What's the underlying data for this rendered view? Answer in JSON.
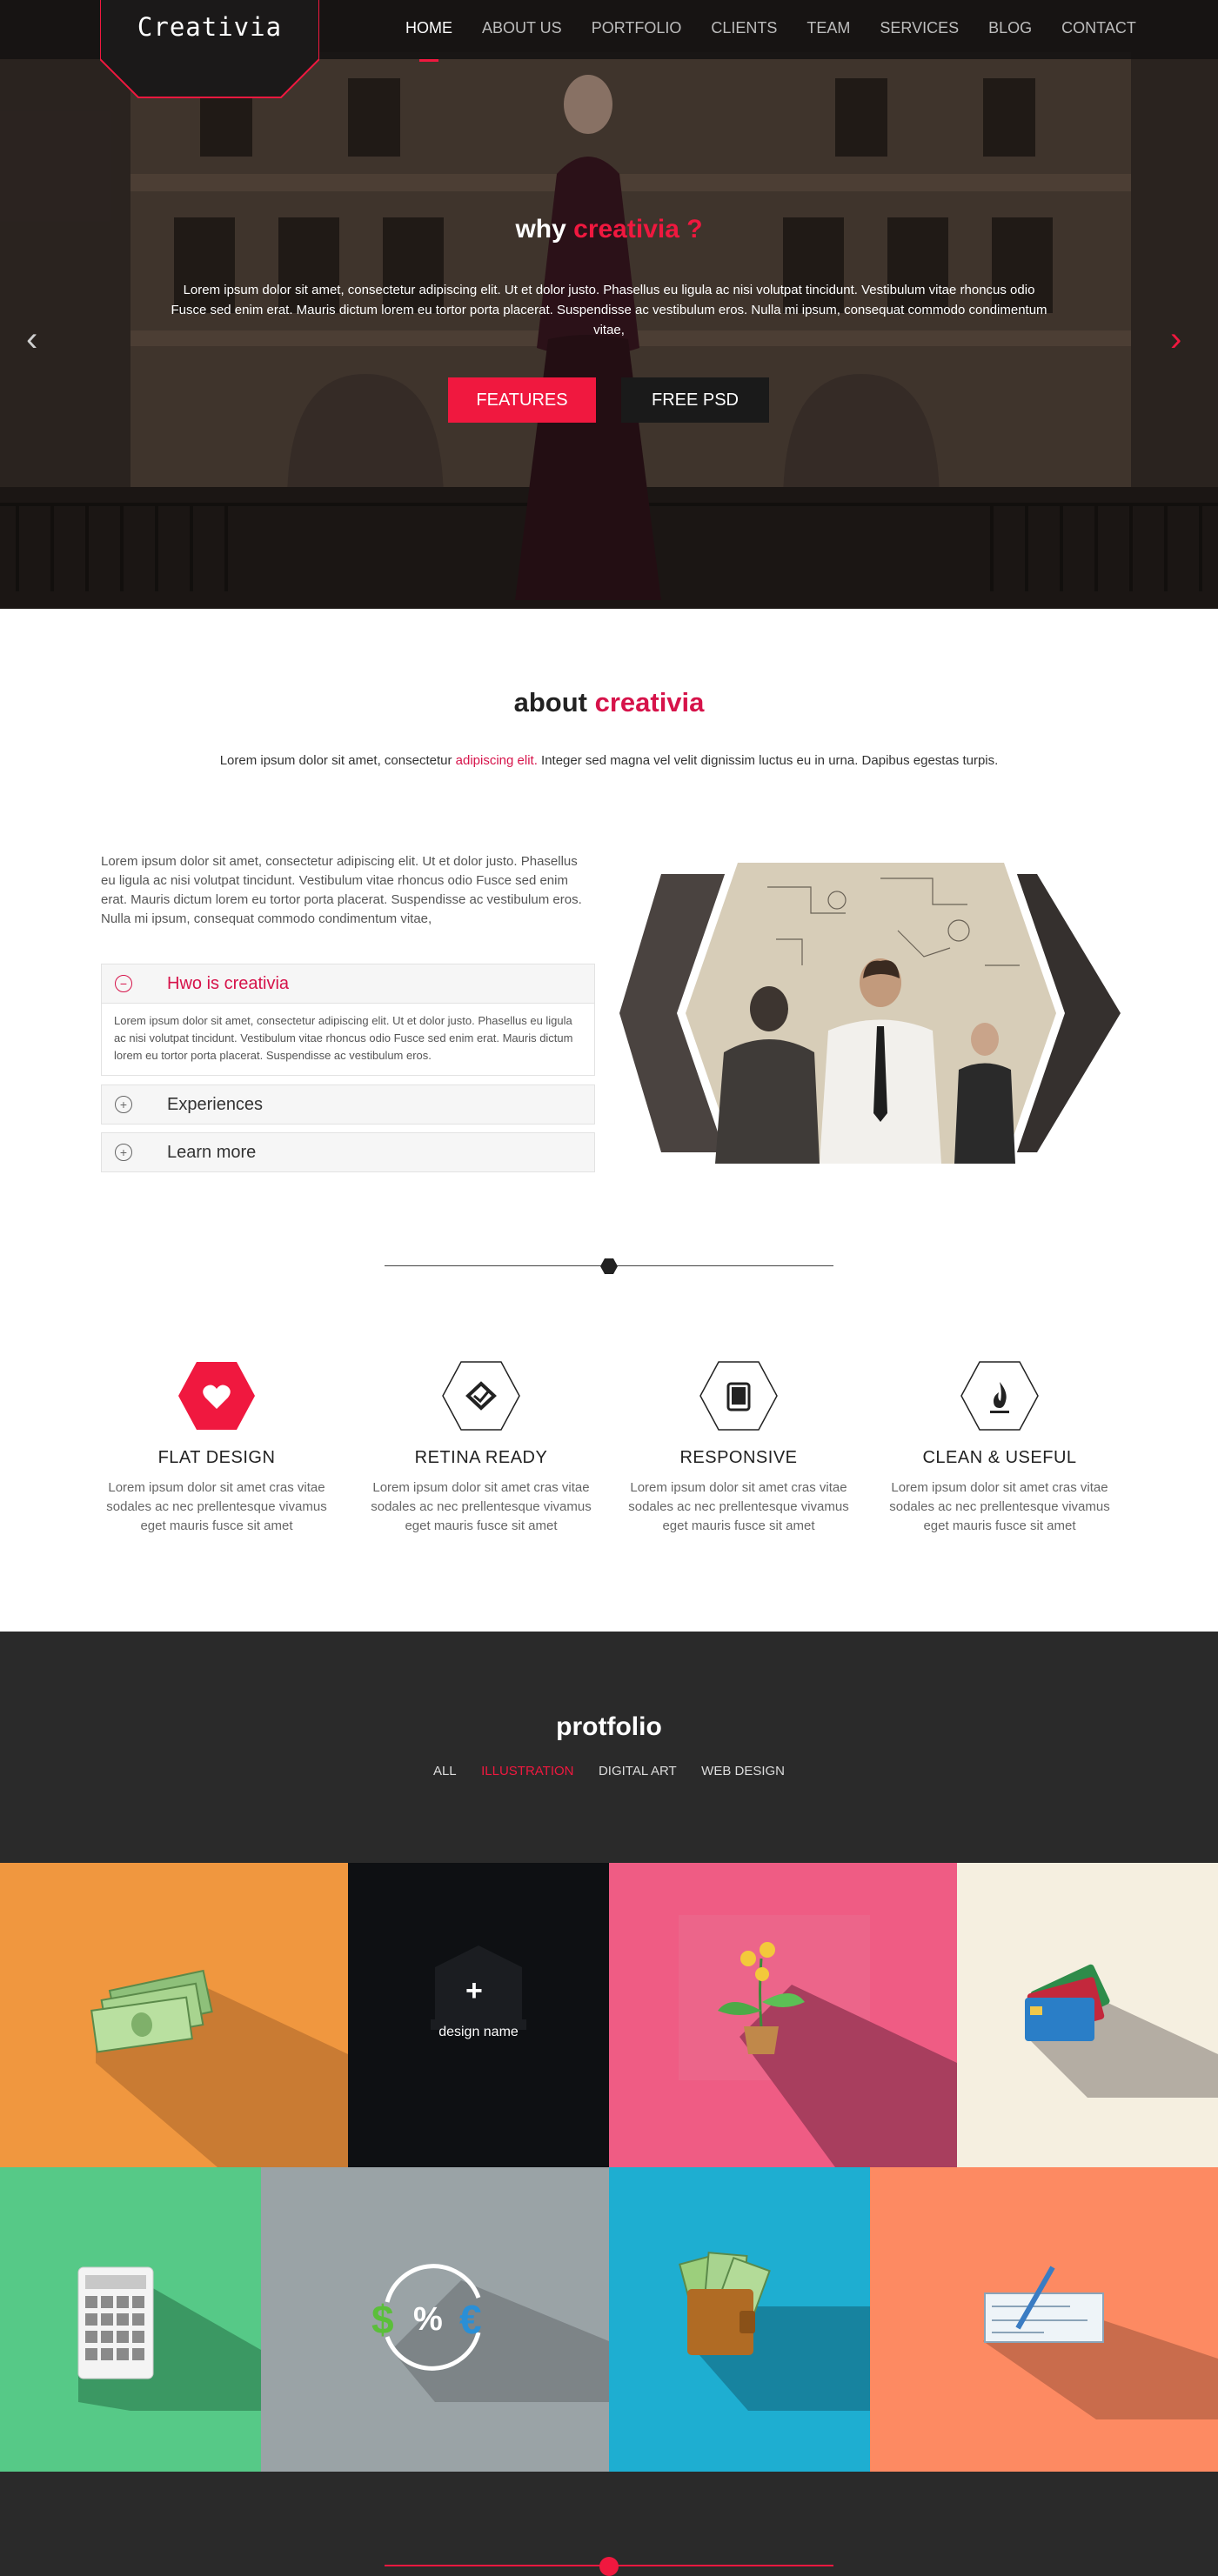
{
  "colors": {
    "accent": "#f0183f",
    "dark": "#2a2a2a",
    "nav_bg": "#141212"
  },
  "brand": {
    "logo_text": "Creativia"
  },
  "nav": {
    "items": [
      "HOME",
      "ABOUT US",
      "PORTFOLIO",
      "CLIENTS",
      "TEAM",
      "SERVICES",
      "BLOG",
      "CONTACT"
    ],
    "active": "HOME"
  },
  "hero": {
    "title_prefix": "why",
    "title_accent": "creativia ?",
    "text": "Lorem ipsum dolor sit amet, consectetur adipiscing elit. Ut et dolor justo. Phasellus eu ligula ac nisi volutpat tincidunt. Vestibulum vitae rhoncus odio Fusce sed enim erat. Mauris dictum lorem eu tortor porta placerat. Suspendisse ac vestibulum eros. Nulla mi ipsum, consequat commodo condimentum vitae,",
    "btn_features": "FEATURES",
    "btn_psd": "FREE PSD",
    "arrow_left": "‹",
    "arrow_right": "›"
  },
  "about": {
    "title_prefix": "about",
    "title_accent": "creativia",
    "lead_before": "Lorem ipsum dolor sit amet, consectetur ",
    "lead_highlight": "adipiscing elit.",
    "lead_after": " Integer sed magna vel velit dignissim luctus eu in urna. Dapibus egestas turpis.",
    "paragraph": "Lorem ipsum dolor sit amet, consectetur adipiscing elit. Ut et dolor justo. Phasellus eu ligula ac nisi volutpat tincidunt. Vestibulum vitae rhoncus odio Fusce sed enim erat. Mauris dictum lorem eu tortor porta placerat. Suspendisse ac vestibulum eros. Nulla mi ipsum, consequat commodo condimentum vitae,",
    "accordion": [
      {
        "label": "Hwo is creativia",
        "icon": "minus-circle-icon",
        "body": "Lorem ipsum dolor sit amet, consectetur adipiscing elit. Ut et dolor justo. Phasellus eu ligula ac nisi volutpat tincidunt. Vestibulum vitae rhoncus odio Fusce sed enim erat. Mauris dictum lorem eu tortor porta placerat. Suspendisse ac vestibulum eros."
      },
      {
        "label": "Experiences",
        "icon": "plus-circle-icon"
      },
      {
        "label": "Learn more",
        "icon": "plus-circle-icon"
      }
    ],
    "minus_glyph": "−",
    "plus_glyph": "+"
  },
  "features": [
    {
      "title": "FLAT DESIGN",
      "icon": "heart-icon",
      "text": "Lorem ipsum dolor sit amet cras vitae sodales ac nec prellentesque vivamus eget mauris fusce sit amet"
    },
    {
      "title": "RETINA READY",
      "icon": "diamond-check-icon",
      "text": "Lorem ipsum dolor sit amet cras vitae sodales ac nec prellentesque vivamus eget mauris fusce sit amet"
    },
    {
      "title": "RESPONSIVE",
      "icon": "tablet-icon",
      "text": "Lorem ipsum dolor sit amet cras vitae sodales ac nec prellentesque vivamus eget mauris fusce sit amet"
    },
    {
      "title": "CLEAN & USEFUL",
      "icon": "flame-icon",
      "text": "Lorem ipsum dolor sit amet cras vitae sodales ac nec prellentesque vivamus eget mauris fusce sit amet"
    }
  ],
  "portfolio": {
    "title": "protfolio",
    "filters": [
      "ALL",
      "ILLUSTRATION",
      "DIGITAL ART",
      "WEB DESIGN"
    ],
    "active_filter": "ILLUSTRATION",
    "hover_plus": "+",
    "hover_caption": "design name",
    "tiles": [
      {
        "icon": "cash-stack-icon",
        "bg": "#f0973f"
      },
      {
        "icon": "bank-icon",
        "bg": "#0e1013"
      },
      {
        "icon": "money-plant-icon",
        "bg": "#ef5c84"
      },
      {
        "icon": "credit-cards-icon",
        "bg": "#f5efe0"
      },
      {
        "icon": "calculator-icon",
        "bg": "#56c987"
      },
      {
        "icon": "currency-exchange-icon",
        "bg": "#9aa3a6"
      },
      {
        "icon": "wallet-icon",
        "bg": "#1eaed1"
      },
      {
        "icon": "check-pen-icon",
        "bg": "#fd8a62"
      }
    ],
    "currency_dollar": "$",
    "currency_percent": "%",
    "currency_euro": "€"
  }
}
